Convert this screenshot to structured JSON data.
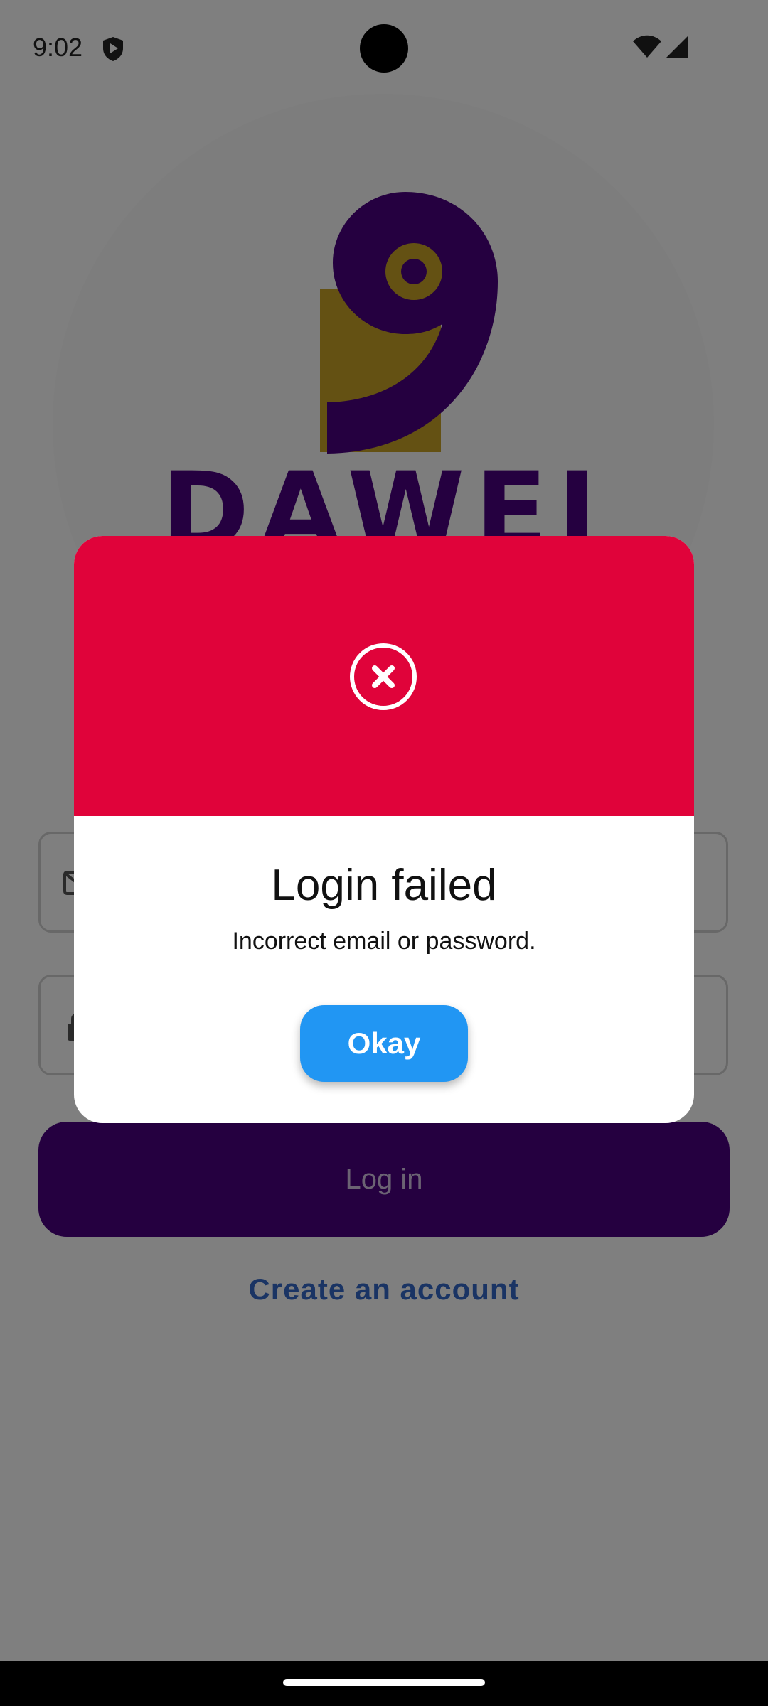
{
  "status_bar": {
    "time": "9:02"
  },
  "logo": {
    "wordmark": "DAWEI"
  },
  "login": {
    "email_placeholder": "",
    "password_placeholder": "",
    "login_label": "Log in",
    "create_account_label": "Create an account"
  },
  "dialog": {
    "title": "Login failed",
    "message": "Incorrect email or password.",
    "okay_label": "Okay"
  },
  "colors": {
    "brand_purple": "#4a0080",
    "brand_gold": "#c9a227",
    "error_red": "#e0033a",
    "button_blue": "#2196f3",
    "link_blue": "#3468c8"
  }
}
